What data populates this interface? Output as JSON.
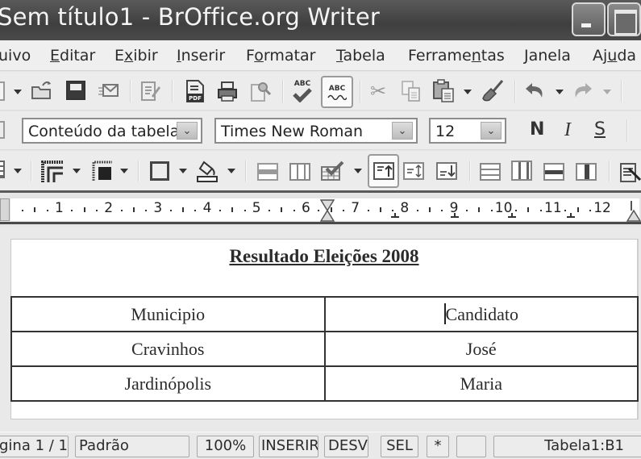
{
  "window": {
    "title": "Sem título1 - BrOffice.org Writer",
    "buttons": [
      "minimize",
      "maximize"
    ]
  },
  "menubar": {
    "items": [
      {
        "label": "uivo",
        "mnemonic": ""
      },
      {
        "pre": "",
        "u": "E",
        "post": "ditar"
      },
      {
        "pre": "E",
        "u": "x",
        "post": "ibir"
      },
      {
        "pre": "",
        "u": "I",
        "post": "nserir"
      },
      {
        "pre": "F",
        "u": "o",
        "post": "rmatar"
      },
      {
        "pre": "",
        "u": "T",
        "post": "abela"
      },
      {
        "pre": "Ferrame",
        "u": "n",
        "post": "tas"
      },
      {
        "pre": "",
        "u": "J",
        "post": "anela"
      },
      {
        "pre": "Aj",
        "u": "u",
        "post": "da"
      }
    ]
  },
  "standard_toolbar": {
    "icons": [
      "new-document-icon",
      "open-folder-icon",
      "save-icon",
      "email-icon",
      "edit-file-icon",
      "export-pdf-icon",
      "print-icon",
      "page-preview-icon",
      "spellcheck-icon",
      "autospellcheck-icon",
      "cut-icon",
      "copy-icon",
      "paste-icon",
      "format-paintbrush-icon",
      "undo-icon",
      "redo-icon"
    ],
    "spellcheck_label": "ABC",
    "autospell_label": "ABC"
  },
  "formatting_toolbar": {
    "paragraph_style": "Conteúdo da tabela",
    "font_name": "Times New Roman",
    "font_size": "12",
    "bold_label": "N",
    "italic_label": "I",
    "underline_label": "S"
  },
  "table_toolbar": {
    "icons": [
      "table-icon",
      "border-style-icon",
      "line-color-icon",
      "borders-icon",
      "background-color-icon",
      "merge-cells-icon",
      "split-cells-icon",
      "autoformat-icon",
      "align-top-icon",
      "center-vertically-icon",
      "align-bottom-icon",
      "insert-rows-icon",
      "insert-columns-icon",
      "delete-rows-icon",
      "delete-columns-icon",
      "table-properties-icon"
    ]
  },
  "ruler": {
    "numbers": [
      "1",
      "2",
      "3",
      "4",
      "5",
      "6",
      "7",
      "8",
      "9",
      "10",
      "11",
      "12"
    ]
  },
  "document": {
    "heading": "Resultado Eleições 2008",
    "table": {
      "rows": [
        [
          "Municipio",
          "Candidato"
        ],
        [
          "Cravinhos",
          "José"
        ],
        [
          "Jardinópolis",
          "Maria"
        ]
      ]
    },
    "cursor_cell": "B1"
  },
  "statusbar": {
    "page": "gina 1 / 1",
    "page_style": "Padrão",
    "zoom": "100%",
    "insert_mode": "INSERIR",
    "selection_mode": "DESV",
    "sel": "SEL",
    "modified": "*",
    "signature": "",
    "position": "Tabela1:B1"
  }
}
